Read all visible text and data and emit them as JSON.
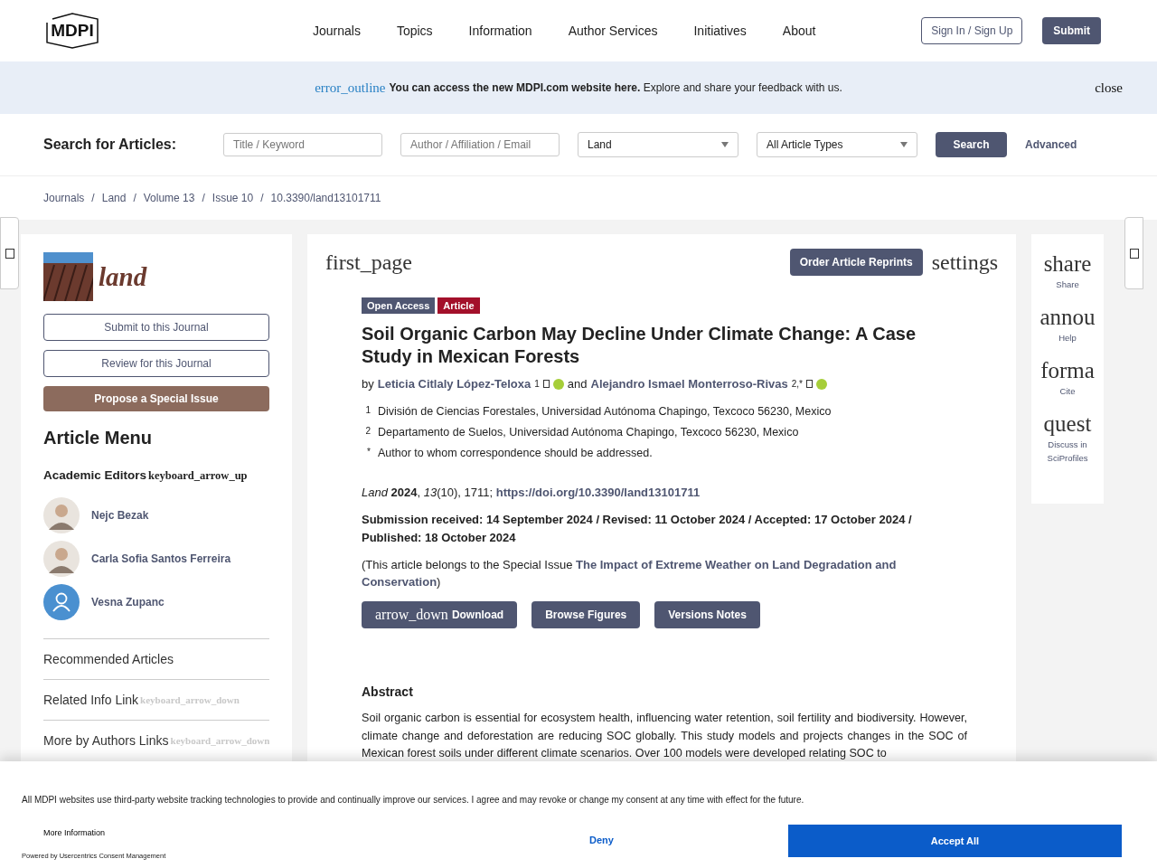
{
  "header": {
    "logo": "MDPI",
    "nav": [
      "Journals",
      "Topics",
      "Information",
      "Author Services",
      "Initiatives",
      "About"
    ],
    "sign_in": "Sign In / Sign Up",
    "submit": "Submit"
  },
  "notice": {
    "icon_text": "error_outline",
    "message": "**You can access the new MDPI.com website here.** Explore and share your feedback with us.",
    "close": "close"
  },
  "search": {
    "label": "Search for Articles:",
    "fields": [
      {
        "placeholder": "Title / Keyword"
      },
      {
        "placeholder": "Author / Affiliation / Email"
      }
    ],
    "selects": [
      "Land",
      "All Article Types"
    ],
    "button": "Search",
    "advanced": "Advanced"
  },
  "breadcrumbs": {
    "separator": "/",
    "items": [
      "Journals",
      "Land",
      "Volume 13",
      "Issue 10",
      "10.3390/land13101711"
    ]
  },
  "sidebar": {
    "journal": "land",
    "buttons": [
      {
        "label": "Submit to this Journal",
        "kind": "outline"
      },
      {
        "label": "Review for this Journal",
        "kind": "outline"
      },
      {
        "label": "Propose a Special Issue",
        "kind": "filled"
      }
    ],
    "menu_title": "Article Menu",
    "editors_title": "Academic Editors",
    "editors_toggle": "keyboard_arrow_up",
    "editors": [
      {
        "name": "Nejc Bezak",
        "kind": "photo"
      },
      {
        "name": "Carla Sofia Santos Ferreira",
        "kind": "photo"
      },
      {
        "name": "Vesna Zupanc",
        "kind": "placeholder"
      }
    ],
    "links": [
      {
        "label": "Recommended Articles"
      },
      {
        "label": "Related Info Link",
        "icon_text": "keyboard_arrow_down"
      },
      {
        "label": "More by Authors Links",
        "icon_text": "keyboard_arrow_down"
      }
    ]
  },
  "article": {
    "toolbar": {
      "left_icon_text": "first_page",
      "reprints": "Order Article Reprints",
      "right_icon_text": "settings"
    },
    "badges": [
      {
        "label": "Open Access",
        "color": "#4f5671"
      },
      {
        "label": "Article",
        "color": "#a3102a"
      }
    ],
    "title": "Soil Organic Carbon May Decline Under Climate Change: A Case Study in Mexican Forests",
    "authors_prefix": "by",
    "authors_joiner": "and",
    "authors": [
      {
        "name": "Leticia Citlaly López-Teloxa",
        "mark": "1"
      },
      {
        "name": "Alejandro Ismael Monterroso-Rivas",
        "mark": "2,*"
      }
    ],
    "affiliations": [
      {
        "mark": "1",
        "text": "División de Ciencias Forestales, Universidad Autónoma Chapingo, Texcoco 56230, Mexico"
      },
      {
        "mark": "2",
        "text": "Departamento de Suelos, Universidad Autónoma Chapingo, Texcoco 56230, Mexico"
      },
      {
        "mark": "*",
        "text": "Author to whom correspondence should be addressed."
      }
    ],
    "citation": {
      "text": "*Land* **2024**, *13*(10), 1711; ",
      "doi": "https://doi.org/10.3390/land13101711"
    },
    "dates": "Submission received: 14 September 2024 / Revised: 11 October 2024 / Accepted: 17 October 2024 / Published: 18 October 2024",
    "special_issue": "(This article belongs to the Special Issue **The Impact of Extreme Weather on Land Degradation and Conservation**)",
    "buttons": [
      {
        "label": "Download",
        "icon_text": "arrow_down"
      },
      {
        "label": "Browse Figures"
      },
      {
        "label": "Versions Notes"
      }
    ],
    "abstract_title": "Abstract",
    "abstract": "Soil organic carbon is essential for ecosystem health, influencing water retention, soil fertility and biodiversity. However, climate change and deforestation are reducing SOC globally. This study models and projects changes in the SOC of Mexican forest soils under different climate scenarios. Over 100 models were developed relating SOC to"
  },
  "tools": [
    {
      "icon_text": "share",
      "label": "Share"
    },
    {
      "icon_text": "annou",
      "label": "Help"
    },
    {
      "icon_text": "forma",
      "label": "Cite"
    },
    {
      "icon_text": "quest",
      "label": "Discuss in SciProfiles"
    }
  ],
  "cookie": {
    "text": "All MDPI websites use third-party website tracking technologies to provide and continually improve our services. I agree and may revoke or change my consent at any time with effect for the future.",
    "more": "More Information",
    "powered": "Powered by Usercentrics Consent Management",
    "deny": "Deny",
    "accept": "Accept All"
  }
}
